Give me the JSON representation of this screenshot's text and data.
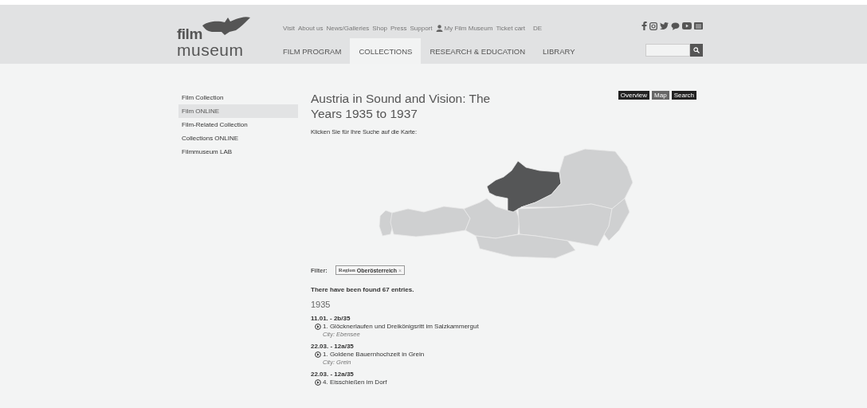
{
  "header": {
    "logo": {
      "line1": "film",
      "line2": "museum"
    },
    "top_links": [
      {
        "label": "Visit",
        "kind": "link"
      },
      {
        "label": "About us",
        "kind": "link"
      },
      {
        "label": "News/Galleries",
        "kind": "link"
      },
      {
        "label": "Shop",
        "kind": "link"
      },
      {
        "label": "Press",
        "kind": "link"
      },
      {
        "label": "Support",
        "kind": "link"
      },
      {
        "label": "My Film Museum",
        "kind": "user"
      },
      {
        "label": "Ticket cart",
        "kind": "link"
      },
      {
        "label": "DE",
        "kind": "lang"
      }
    ],
    "nav": [
      {
        "label": "FILM PROGRAM",
        "selected": false
      },
      {
        "label": "COLLECTIONS",
        "selected": true
      },
      {
        "label": "RESEARCH & EDUCATION",
        "selected": false
      },
      {
        "label": "LIBRARY",
        "selected": false
      }
    ],
    "social": [
      {
        "kind": "facebook"
      },
      {
        "kind": "instagram"
      },
      {
        "kind": "twitter"
      },
      {
        "kind": "chat"
      },
      {
        "kind": "youtube"
      },
      {
        "kind": "newsletter"
      }
    ]
  },
  "sidebar": {
    "items": [
      {
        "label": "Film Collection",
        "selected": false
      },
      {
        "label": "Film ONLINE",
        "selected": true
      },
      {
        "label": "Film-Related Collection",
        "selected": false
      },
      {
        "label": "Collections ONLINE",
        "selected": false
      },
      {
        "label": "Filmmuseum LAB",
        "selected": false
      }
    ]
  },
  "main": {
    "title": "Austria in Sound and Vision: The Years 1935 to 1937",
    "view_buttons": [
      {
        "label": "Overview",
        "selected": false
      },
      {
        "label": "Map",
        "selected": true
      },
      {
        "label": "Search",
        "selected": false
      }
    ],
    "instruction": "Klicken Sie für Ihre Suche auf die Karte:",
    "map": {
      "regions": [
        {
          "selected": false
        },
        {
          "selected": false
        },
        {
          "selected": false
        },
        {
          "selected": true
        },
        {
          "selected": false
        },
        {
          "selected": false
        },
        {
          "selected": false
        },
        {
          "selected": false
        }
      ]
    },
    "filter": {
      "label": "Filter:",
      "tag": {
        "name": "Region",
        "value": "Oberösterreich",
        "remove": "×"
      }
    },
    "result_count": "There have been found 67 entries.",
    "year": "1935",
    "entries": [
      {
        "date": "11.01. - 2b/35",
        "title": "1. Glöcknerlaufen und Dreikönigsritt im Salzkammergut",
        "city": "City: Ebensee"
      },
      {
        "date": "22.03. - 12a/35",
        "title": "1. Goldene Bauernhochzeit in Grein",
        "city": "City: Grein"
      },
      {
        "date": "22.03. - 12a/35",
        "title": "4. Eisschießen im Dorf"
      }
    ]
  }
}
